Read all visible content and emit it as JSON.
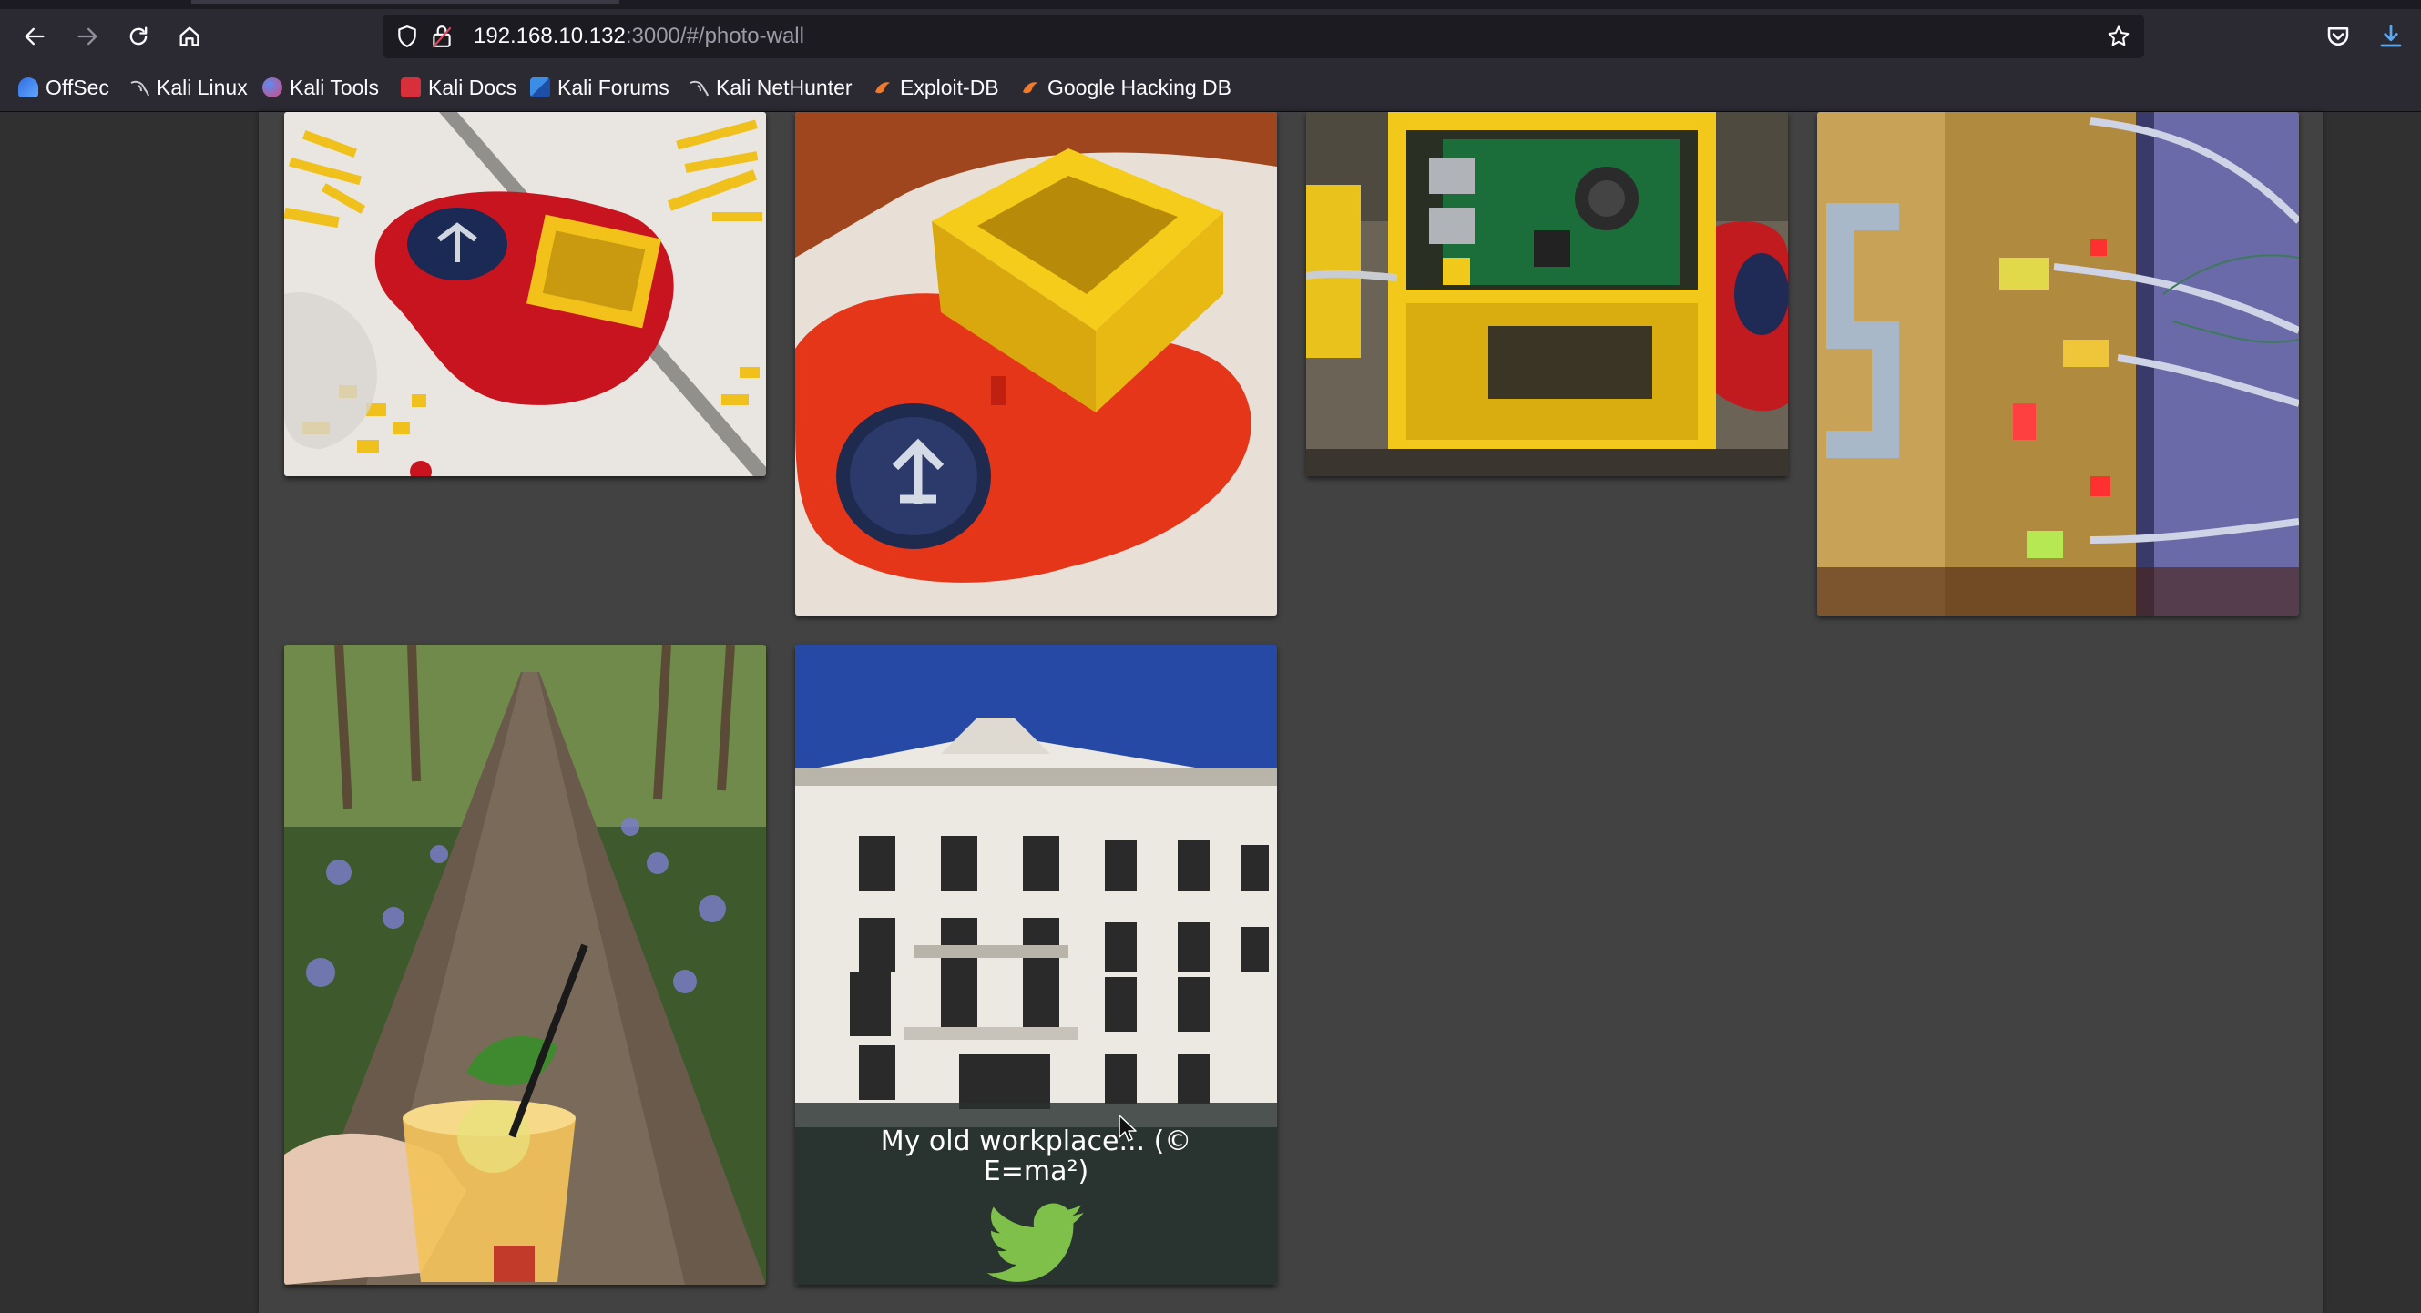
{
  "browser": {
    "url_host": "192.168.10.132",
    "url_rest": ":3000/#/photo-wall",
    "bookmarks": [
      {
        "label": "OffSec",
        "icon": "offsec-icon",
        "color": "#3b82f6"
      },
      {
        "label": "Kali Linux",
        "icon": "kali-dragon-icon",
        "color": "#cfcfd6"
      },
      {
        "label": "Kali Tools",
        "icon": "kali-tools-icon",
        "color": "#e0457b"
      },
      {
        "label": "Kali Docs",
        "icon": "kali-docs-icon",
        "color": "#e03a3a"
      },
      {
        "label": "Kali Forums",
        "icon": "kali-forums-icon",
        "color": "#3b8ee8"
      },
      {
        "label": "Kali NetHunter",
        "icon": "kali-dragon-icon",
        "color": "#cfcfd6"
      },
      {
        "label": "Exploit-DB",
        "icon": "exploit-db-icon",
        "color": "#f07a2b"
      },
      {
        "label": "Google Hacking DB",
        "icon": "ghdb-icon",
        "color": "#f07a2b"
      }
    ]
  },
  "photo_wall": {
    "photos": [
      {
        "name": "photo-lego-red-base"
      },
      {
        "name": "photo-lego-yellow-box"
      },
      {
        "name": "photo-raspberry-pi-case"
      },
      {
        "name": "photo-lego-server-tower"
      },
      {
        "name": "photo-forest-path-drink"
      },
      {
        "name": "photo-old-workplace",
        "caption": "My old workplace... (© E=ma²)",
        "caption_icon": "twitter-icon"
      }
    ]
  },
  "colors": {
    "page_bg": "#303030",
    "wall_bg": "#424242",
    "browser_bg": "#2b2a33",
    "url_bg": "#1c1b22",
    "accent_blue": "#5aa8f0"
  }
}
